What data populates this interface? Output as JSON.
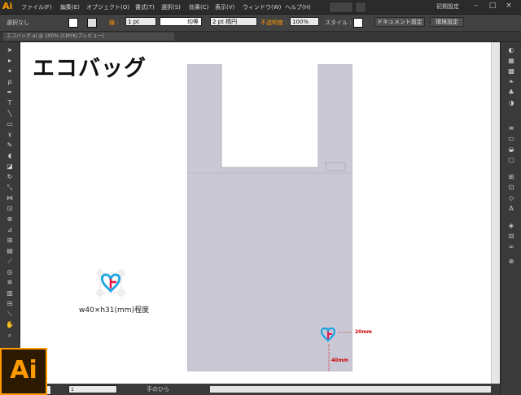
{
  "app": {
    "logo_text": "Ai",
    "workspace": "初期設定",
    "big_logo_text": "Ai"
  },
  "menu": {
    "items": [
      "ファイル(F)",
      "編集(E)",
      "オブジェクト(O)",
      "書式(T)",
      "選択(S)",
      "効果(C)",
      "表示(V)",
      "ウィンドウ(W)",
      "ヘルプ(H)"
    ]
  },
  "window_controls": [
    "–",
    "□",
    "×"
  ],
  "control_bar": {
    "selection": "選択なし",
    "stroke_label": "線 :",
    "stroke_weight": "1 pt",
    "stroke_profile": "均等",
    "brush": "2 pt 楕円",
    "opacity_label": "不透明度 :",
    "opacity_value": "100%",
    "style_label": "スタイル :",
    "doc_setup_button": "ドキュメント設定",
    "prefs_button": "環境設定"
  },
  "tab": {
    "document_title": "エコバッグ.ai @ 100% (CMYK/プレビュー)"
  },
  "artboard": {
    "title": "エコバッグ",
    "logo_size_text": "w40×h31(mm)程度",
    "dimension_right": "20mm",
    "dimension_bottom": "40mm"
  },
  "status_bar": {
    "zoom": "1",
    "tool_name": "手のひら"
  },
  "colors": {
    "bag_fill": "#c9c8d4",
    "logo_blue": "#1aa3e0",
    "logo_red": "#e5184c",
    "accent_orange": "#ff9a00",
    "dimension_red": "#cc0000"
  },
  "icons": {
    "tools_left": [
      "selection-icon",
      "direct-selection-icon",
      "magic-wand-icon",
      "lasso-icon",
      "pen-icon",
      "type-icon",
      "line-icon",
      "rectangle-icon",
      "paintbrush-icon",
      "pencil-icon",
      "blob-brush-icon",
      "eraser-icon",
      "rotate-icon",
      "scale-icon",
      "width-icon",
      "free-transform-icon",
      "shape-builder-icon",
      "perspective-icon",
      "mesh-icon",
      "gradient-icon",
      "eyedropper-icon",
      "blend-icon",
      "symbol-sprayer-icon",
      "column-graph-icon",
      "artboard-icon",
      "slice-icon",
      "hand-icon",
      "zoom-icon"
    ],
    "panels_right": [
      "color-icon",
      "color-guide-icon",
      "swatches-icon",
      "brushes-icon",
      "symbols-icon",
      "graphic-styles-icon",
      "stroke-icon",
      "gradient-panel-icon",
      "transparency-icon",
      "appearance-icon",
      "align-icon",
      "transform-icon",
      "character-icon",
      "paragraph-icon",
      "layers-icon",
      "artboards-icon",
      "links-icon",
      "pathfinder-icon"
    ]
  }
}
